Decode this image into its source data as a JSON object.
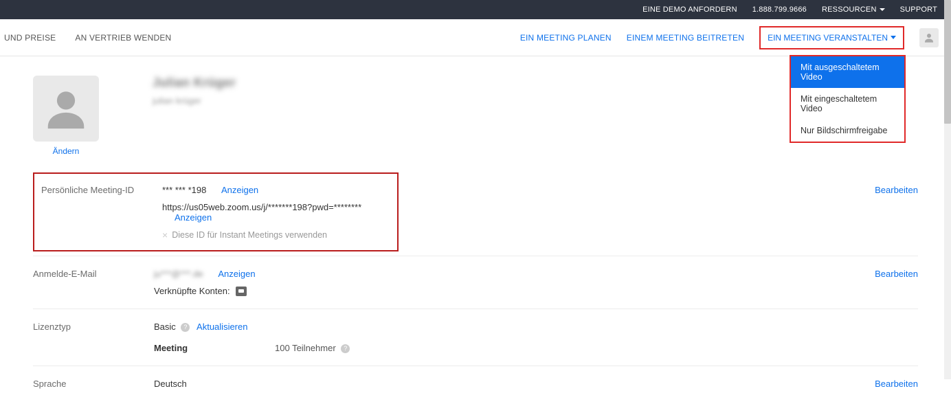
{
  "topbar": {
    "demo": "EINE DEMO ANFORDERN",
    "phone": "1.888.799.9666",
    "resources": "RESSOURCEN",
    "support": "SUPPORT"
  },
  "navbar": {
    "left": {
      "pricing": "UND PREISE",
      "contact_sales": "AN VERTRIEB WENDEN"
    },
    "right": {
      "schedule": "EIN MEETING PLANEN",
      "join": "EINEM MEETING BEITRETEN",
      "host": "EIN MEETING VERANSTALTEN"
    }
  },
  "dropdown": {
    "video_off": "Mit ausgeschaltetem Video",
    "video_on": "Mit eingeschaltetem Video",
    "screen_only": "Nur Bildschirmfreigabe"
  },
  "profile": {
    "change": "Ändern",
    "name_blurred": "Julian Krüger",
    "sub_blurred": "julian krüger"
  },
  "meeting_id": {
    "label": "Persönliche Meeting-ID",
    "id_masked": "*** *** *198",
    "show": "Anzeigen",
    "url_masked": "https://us05web.zoom.us/j/*******198?pwd=********",
    "instant_text": "Diese ID für Instant Meetings verwenden",
    "edit": "Bearbeiten"
  },
  "email": {
    "label": "Anmelde-E-Mail",
    "value_blurred": "ju***@***.de",
    "show": "Anzeigen",
    "linked_label": "Verknüpfte Konten:",
    "edit": "Bearbeiten"
  },
  "license": {
    "label": "Lizenztyp",
    "basic": "Basic",
    "upgrade": "Aktualisieren",
    "meeting_label": "Meeting",
    "participants": "100 Teilnehmer"
  },
  "language": {
    "label": "Sprache",
    "value": "Deutsch",
    "edit": "Bearbeiten"
  }
}
